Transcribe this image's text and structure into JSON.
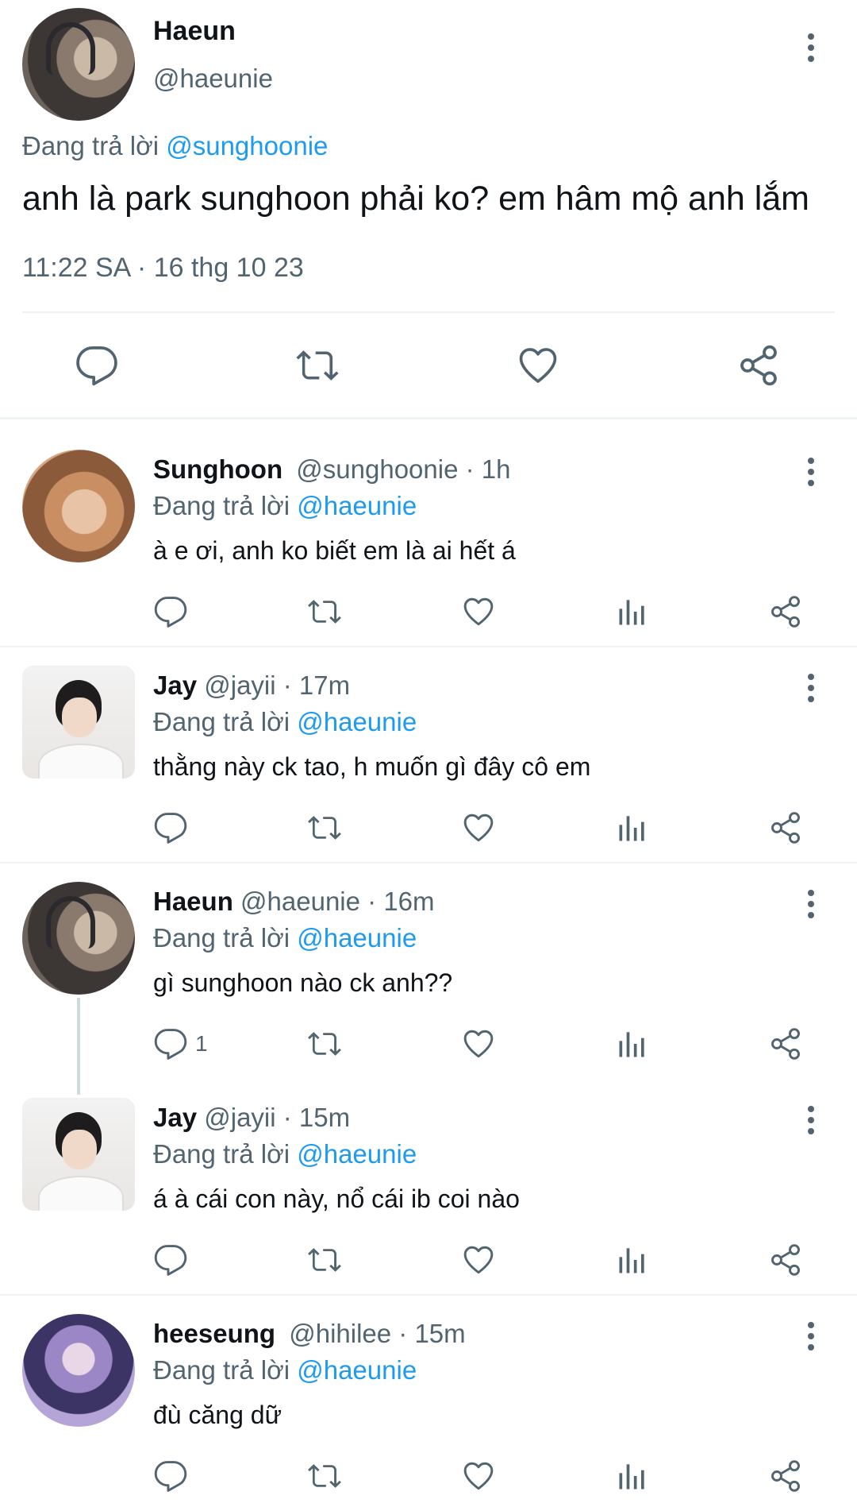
{
  "main_tweet": {
    "name": "Haeun",
    "handle": "@haeunie",
    "replying_prefix": "Đang trả lời",
    "replying_to": "@sunghoonie",
    "text": "anh là park sunghoon phải ko? em hâm mộ anh lắm",
    "timestamp": "11:22 SA · 16 thg 10 23",
    "actions": [
      "reply-icon",
      "retweet-icon",
      "like-icon",
      "share-icon"
    ]
  },
  "replies": [
    {
      "name": "Sunghoon",
      "handle": "@sunghoonie",
      "time": "· 1h",
      "replying_prefix": "Đang trả lời",
      "replying_to": "@haeunie",
      "text": "à e ơi, anh ko biết em là ai hết á",
      "reply_count": ""
    },
    {
      "name": "Jay",
      "handle": "@jayii",
      "time": "· 17m",
      "replying_prefix": "Đang trả lời",
      "replying_to": "@haeunie",
      "text": "thằng này ck tao, h muốn gì đây cô em",
      "reply_count": ""
    },
    {
      "name": "Haeun",
      "handle": "@haeunie",
      "time": "· 16m",
      "replying_prefix": "Đang trả lời",
      "replying_to": "@haeunie",
      "text": "gì sunghoon nào ck anh??",
      "reply_count": "1"
    },
    {
      "name": "Jay",
      "handle": "@jayii",
      "time": "· 15m",
      "replying_prefix": "Đang trả lời",
      "replying_to": "@haeunie",
      "text": "á à cái con này, nổ cái ib coi nào",
      "reply_count": ""
    },
    {
      "name": "heeseung",
      "handle": "@hihilee",
      "time": "· 15m",
      "replying_prefix": "Đang trả lời",
      "replying_to": "@haeunie",
      "text": "đù căng dữ",
      "reply_count": ""
    }
  ],
  "reply_actions": [
    "reply-icon",
    "retweet-icon",
    "like-icon",
    "views-icon",
    "share-icon"
  ],
  "colors": {
    "accent": "#1d9bf0",
    "muted": "#536471",
    "divider": "#eff3f4"
  }
}
